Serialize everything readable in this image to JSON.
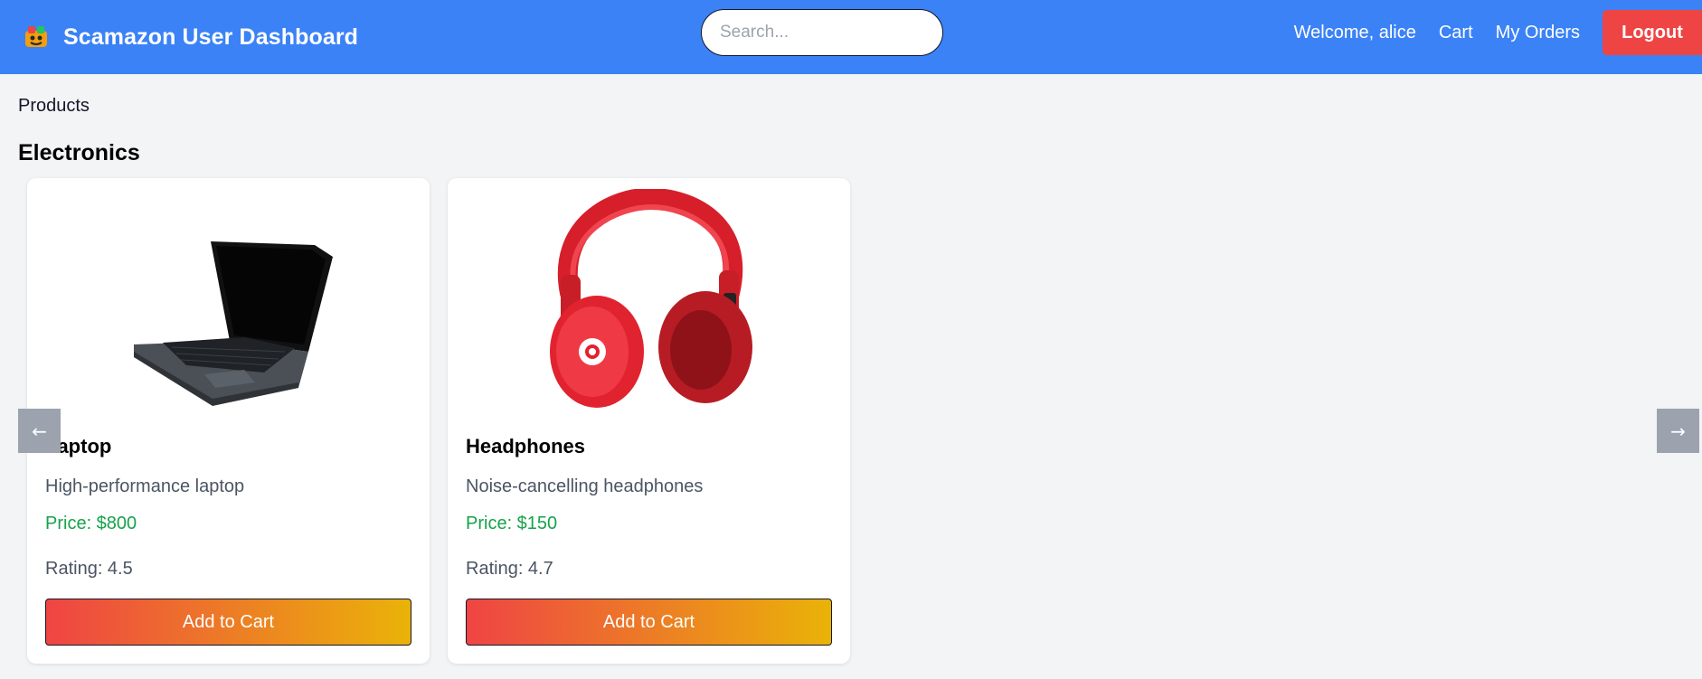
{
  "header": {
    "title": "Scamazon User Dashboard",
    "logo_icon": "scamazon-logo-icon",
    "search_placeholder": "Search...",
    "welcome": "Welcome, alice",
    "cart": "Cart",
    "orders": "My Orders",
    "logout": "Logout",
    "color": "#3b82f6",
    "logout_color": "#ef4444"
  },
  "breadcrumb": "Products",
  "category": "Electronics",
  "carousel": {
    "prev": "←",
    "next": "→"
  },
  "products": [
    {
      "name": "Laptop",
      "image_icon": "laptop-image",
      "description": "High-performance laptop",
      "price": "Price: $800",
      "rating": "Rating: 4.5",
      "button": "Add to Cart"
    },
    {
      "name": "Headphones",
      "image_icon": "headphones-image",
      "description": "Noise-cancelling headphones",
      "price": "Price: $150",
      "rating": "Rating: 4.7",
      "button": "Add to Cart"
    }
  ]
}
